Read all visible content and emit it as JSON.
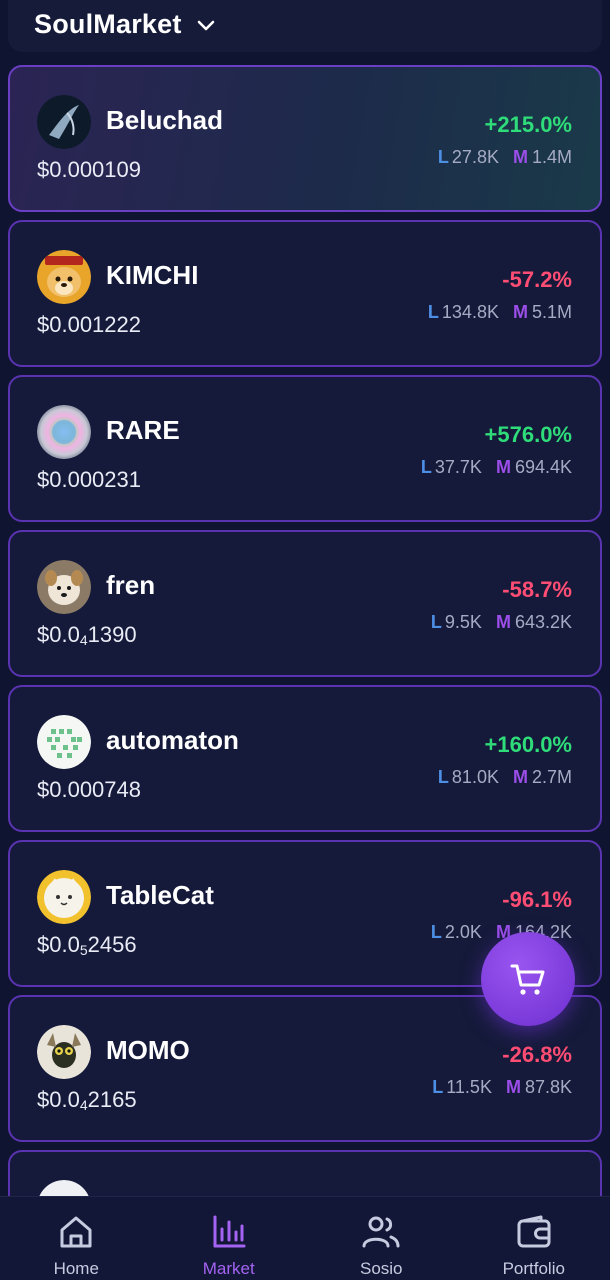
{
  "header": {
    "title": "SoulMarket"
  },
  "tokens": [
    {
      "name": "Beluchad",
      "price": "$0.000109",
      "change": "+215.0%",
      "liquidity": "27.8K",
      "mcap": "1.4M"
    },
    {
      "name": "KIMCHI",
      "price": "$0.001222",
      "change": "-57.2%",
      "liquidity": "134.8K",
      "mcap": "5.1M"
    },
    {
      "name": "RARE",
      "price": "$0.000231",
      "change": "+576.0%",
      "liquidity": "37.7K",
      "mcap": "694.4K"
    },
    {
      "name": "fren",
      "price_prefix": "$0.0",
      "price_sub": "4",
      "price_suffix": "1390",
      "change": "-58.7%",
      "liquidity": "9.5K",
      "mcap": "643.2K"
    },
    {
      "name": "automaton",
      "price": "$0.000748",
      "change": "+160.0%",
      "liquidity": "81.0K",
      "mcap": "2.7M"
    },
    {
      "name": "TableCat",
      "price_prefix": "$0.0",
      "price_sub": "5",
      "price_suffix": "2456",
      "change": "-96.1%",
      "liquidity": "2.0K",
      "mcap": "164.2K"
    },
    {
      "name": "MOMO",
      "price_prefix": "$0.0",
      "price_sub": "4",
      "price_suffix": "2165",
      "change": "-26.8%",
      "liquidity": "11.5K",
      "mcap": "87.8K"
    }
  ],
  "stat_labels": {
    "liquidity": "L",
    "mcap": "M"
  },
  "nav": [
    {
      "label": "Home"
    },
    {
      "label": "Market"
    },
    {
      "label": "Sosio"
    },
    {
      "label": "Portfolio"
    }
  ],
  "colors": {
    "up": "#2fdc7a",
    "down": "#ff4d74",
    "accent": "#a463f2"
  }
}
